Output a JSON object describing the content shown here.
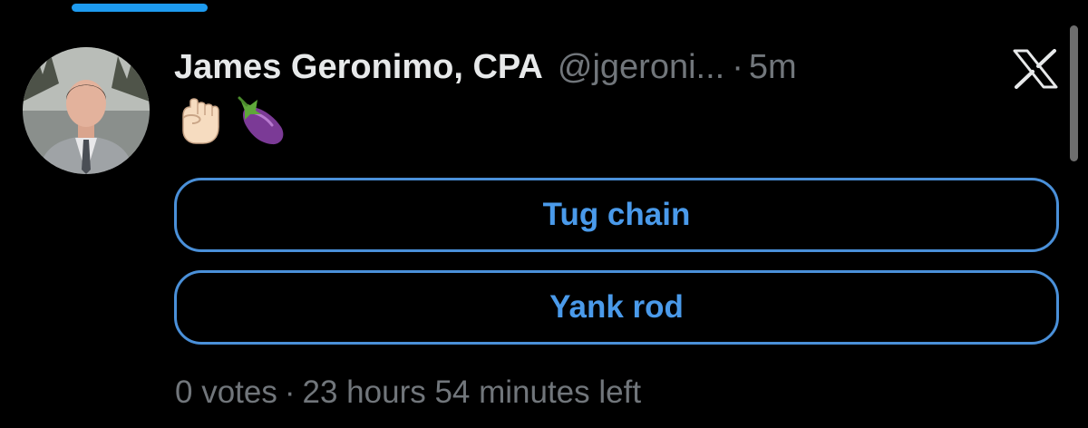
{
  "tweet": {
    "author": {
      "display_name": "James Geronimo, CPA",
      "handle": "@jgeroni...",
      "avatar": "profile-photo"
    },
    "separator": "·",
    "timestamp": "5m",
    "platform_icon": "x-logo-icon",
    "body_emoji": [
      "fist-emoji",
      "eggplant-emoji"
    ]
  },
  "poll": {
    "options": [
      {
        "label": "Tug chain"
      },
      {
        "label": "Yank rod"
      }
    ],
    "votes": "0 votes",
    "separator": "·",
    "time_left": "23 hours 54 minutes left"
  },
  "colors": {
    "background": "#000000",
    "accent": "#1d9bf0",
    "option_text": "#4a9aea",
    "muted": "#71767b",
    "text": "#e7e9ea"
  }
}
